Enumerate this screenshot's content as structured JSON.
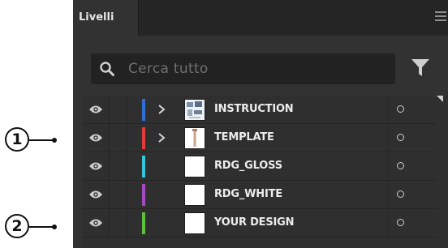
{
  "panel": {
    "tab_label": "Livelli",
    "menu_icon": "hamburger-menu-icon"
  },
  "search": {
    "placeholder": "Cerca tutto",
    "icon": "search-icon",
    "filter_icon": "filter-icon"
  },
  "layers": [
    {
      "name": "INSTRUCTION",
      "color": "#2f6fd4",
      "expandable": true,
      "visible": true
    },
    {
      "name": "TEMPLATE",
      "color": "#e23b3b",
      "expandable": true,
      "visible": true
    },
    {
      "name": "RDG_GLOSS",
      "color": "#38c4d9",
      "expandable": false,
      "visible": true
    },
    {
      "name": "RDG_WHITE",
      "color": "#a24cc0",
      "expandable": false,
      "visible": true
    },
    {
      "name": "YOUR DESIGN",
      "color": "#5bc13c",
      "expandable": false,
      "visible": true
    }
  ],
  "callouts": [
    {
      "label": "1"
    },
    {
      "label": "2"
    }
  ]
}
